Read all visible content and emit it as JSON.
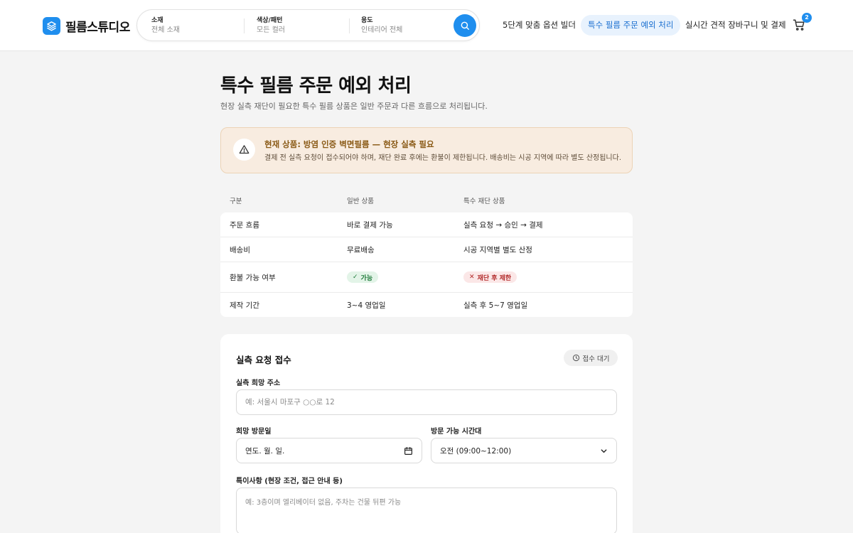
{
  "app": {
    "logo_text": "필름스튜디오"
  },
  "search": {
    "segments": [
      {
        "label": "소재",
        "value": "전체 소재"
      },
      {
        "label": "색상/패턴",
        "value": "모든 컬러"
      },
      {
        "label": "용도",
        "value": "인테리어 전체"
      }
    ]
  },
  "nav": {
    "items": [
      {
        "label": "5단계 맞춤 옵션 빌더"
      },
      {
        "label": "특수 필름 주문 예외 처리"
      },
      {
        "label": "실시간 견적 장바구니 및 결제"
      }
    ],
    "cart_count": "2"
  },
  "page": {
    "title": "특수 필름 주문 예외 처리",
    "subtitle": "현장 실측 재단이 필요한 특수 필름 상품은 일반 주문과 다른 흐름으로 처리됩니다."
  },
  "alert": {
    "title": "현재 상품: 방염 인증 벽면필름 — 현장 실측 필요",
    "description": "결제 전 실측 요청이 접수되어야 하며, 재단 완료 후에는 환불이 제한됩니다. 배송비는 시공 지역에 따라 별도 산정됩니다."
  },
  "table": {
    "headers": [
      "구분",
      "일반 상품",
      "특수 재단 상품"
    ],
    "rows": [
      {
        "label": "주문 흐름",
        "normal": "바로 결제 가능",
        "special": "실측 요청 → 승인 → 결제"
      },
      {
        "label": "배송비",
        "normal": "무료배송",
        "special": "시공 지역별 별도 산정"
      },
      {
        "label": "환불 가능 여부",
        "normal": "가능",
        "special": "재단 후 제한"
      },
      {
        "label": "제작 기간",
        "normal": "3~4 영업일",
        "special": "실측 후 5~7 영업일"
      }
    ]
  },
  "form": {
    "title": "실측 요청 접수",
    "status": "접수 대기",
    "address_label": "실측 희망 주소",
    "address_placeholder": "예: 서울시 마포구 ○○로 12",
    "date_label": "희망 방문일",
    "date_value": "연도. 월. 일.",
    "time_label": "방문 가능 시간대",
    "time_value": "오전 (09:00~12:00)",
    "notes_label": "특이사항 (현장 조건, 접근 안내 등)",
    "notes_placeholder": "예: 3층이며 엘리베이터 없음, 주차는 건물 뒤편 가능"
  },
  "colors": {
    "accent": "#1f8eee",
    "alert_bg": "#f8ece0",
    "alert_title": "#8a5a16",
    "ok": "#1f7a3a",
    "no": "#b22a2a"
  }
}
